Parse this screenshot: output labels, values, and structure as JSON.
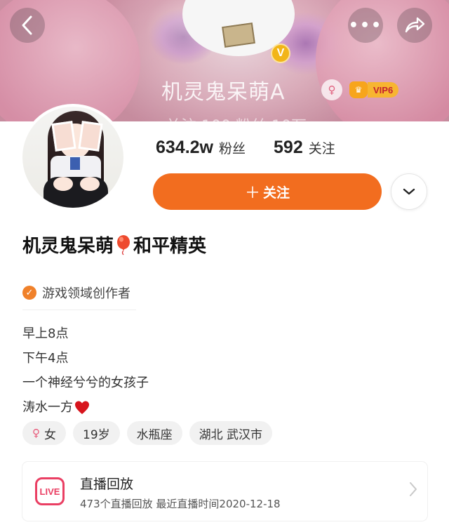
{
  "header": {
    "profile_name_ghost": "机灵鬼呆萌A",
    "verified_badge": "V",
    "vip_label": "VIP6",
    "stats_ghost": "关注 100  粉丝 10万"
  },
  "nav": {
    "back_icon": "chevron-left-icon",
    "more_label": "•••",
    "share_icon": "share-icon"
  },
  "profile": {
    "followers_count": "634.2w",
    "followers_label": "粉丝",
    "following_count": "592",
    "following_label": "关注",
    "follow_button_label": "关注",
    "username_part1": "机灵鬼呆萌",
    "username_part2": "和平精英",
    "certification": "游戏领域创作者",
    "bio_lines": [
      "早上8点",
      "下午4点",
      "一个神经兮兮的女孩子",
      "涛水一方"
    ],
    "tags": {
      "gender": "女",
      "age": "19岁",
      "zodiac": "水瓶座",
      "location": "湖北 武汉市"
    }
  },
  "live_replay": {
    "icon_label": "LIVE",
    "title": "直播回放",
    "subtitle": "473个直播回放  最近直播时间2020-12-18"
  },
  "colors": {
    "accent_orange": "#f26d1f",
    "live_red": "#ea3f63",
    "cert_orange": "#f0812a"
  }
}
